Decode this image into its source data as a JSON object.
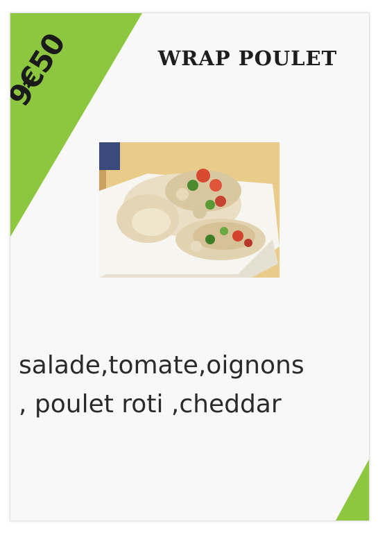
{
  "menu_card": {
    "price": "9€50",
    "title": "WRAP POULET",
    "ingredients_line1": "salade,tomate,oignons",
    "ingredients_line2": ", poulet roti ,cheddar"
  },
  "colors": {
    "accent": "#8dc63f",
    "text": "#1e1e1e",
    "background": "#f8f8f9"
  }
}
